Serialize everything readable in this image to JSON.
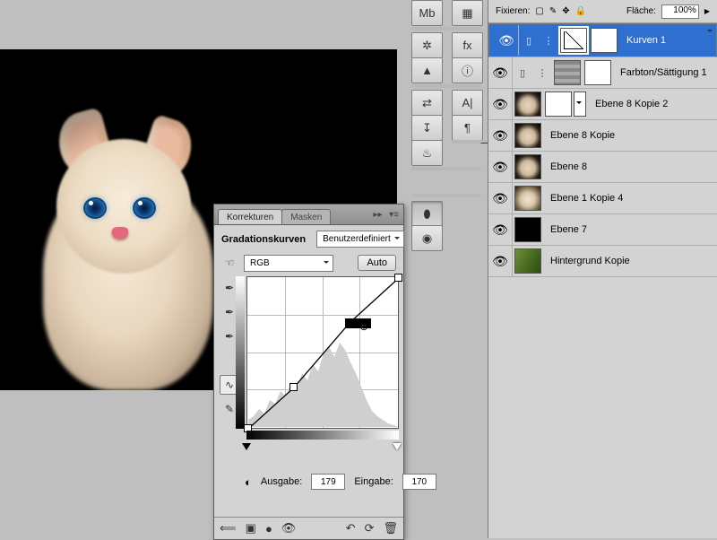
{
  "toolbar_icons": [
    "Mb",
    "▦",
    "✲",
    "fx",
    "▲",
    "ⓘ",
    "⇄",
    "A|",
    "↧",
    "¶",
    "♨",
    "—",
    "⬮",
    "◉"
  ],
  "panel": {
    "tab_active": "Korrekturen",
    "tab_inactive": "Masken",
    "title": "Gradationskurven",
    "preset": "Benutzerdefiniert",
    "channel": "RGB",
    "auto": "Auto",
    "output_label": "Ausgabe:",
    "output_value": "179",
    "input_label": "Eingabe:",
    "input_value": "170",
    "points": [
      {
        "x": 0,
        "y": 168
      },
      {
        "x": 51,
        "y": 122
      },
      {
        "x": 113,
        "y": 50,
        "selected": true
      },
      {
        "x": 168,
        "y": 0
      }
    ]
  },
  "lock_label": "Fixieren:",
  "fill_label": "Fläche:",
  "fill_value": "100%",
  "layers": [
    {
      "name": "Kurven 1",
      "thumb": "curves",
      "mask": true,
      "selected": true,
      "adj": true
    },
    {
      "name": "Farbton/Sättigung 1",
      "thumb": "hs",
      "mask": true,
      "adj": true
    },
    {
      "name": "Ebene 8 Kopie 2",
      "thumb": "cat",
      "mask": true,
      "vsel": true
    },
    {
      "name": "Ebene 8 Kopie",
      "thumb": "cat"
    },
    {
      "name": "Ebene 8",
      "thumb": "cat"
    },
    {
      "name": "Ebene 1 Kopie 4",
      "thumb": "cat2"
    },
    {
      "name": "Ebene 7",
      "thumb": "black"
    },
    {
      "name": "Hintergrund Kopie",
      "thumb": "bg"
    }
  ],
  "chart_data": {
    "type": "line",
    "title": "Gradationskurven",
    "xlabel": "Eingabe",
    "ylabel": "Ausgabe",
    "xlim": [
      0,
      255
    ],
    "ylim": [
      0,
      255
    ],
    "series": [
      {
        "name": "RGB",
        "values": [
          [
            0,
            0
          ],
          [
            77,
            70
          ],
          [
            170,
            179
          ],
          [
            255,
            255
          ]
        ]
      }
    ]
  }
}
